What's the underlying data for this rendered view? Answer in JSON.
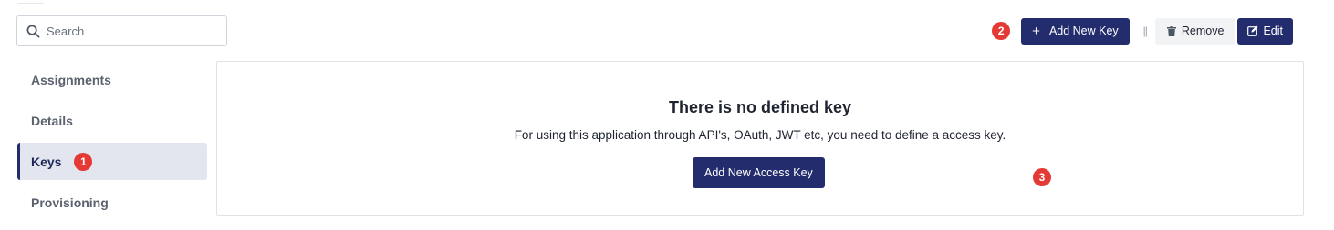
{
  "search": {
    "placeholder": "Search",
    "value": ""
  },
  "toolbar": {
    "badge": "2",
    "add_key_label": "Add New Key",
    "separator": "||",
    "remove_label": "Remove",
    "edit_label": "Edit"
  },
  "sidebar": {
    "items": [
      {
        "label": "Assignments"
      },
      {
        "label": "Details"
      },
      {
        "label": "Keys",
        "badge": "1"
      },
      {
        "label": "Provisioning"
      }
    ]
  },
  "panel": {
    "title": "There is no defined key",
    "text": "For using this application through API's, OAuth, JWT etc, you need to define a access key.",
    "button_label": "Add New Access Key",
    "badge": "3"
  },
  "colors": {
    "primary": "#232d6e",
    "badge": "#e53935",
    "active_bg": "#e3e6ee"
  }
}
